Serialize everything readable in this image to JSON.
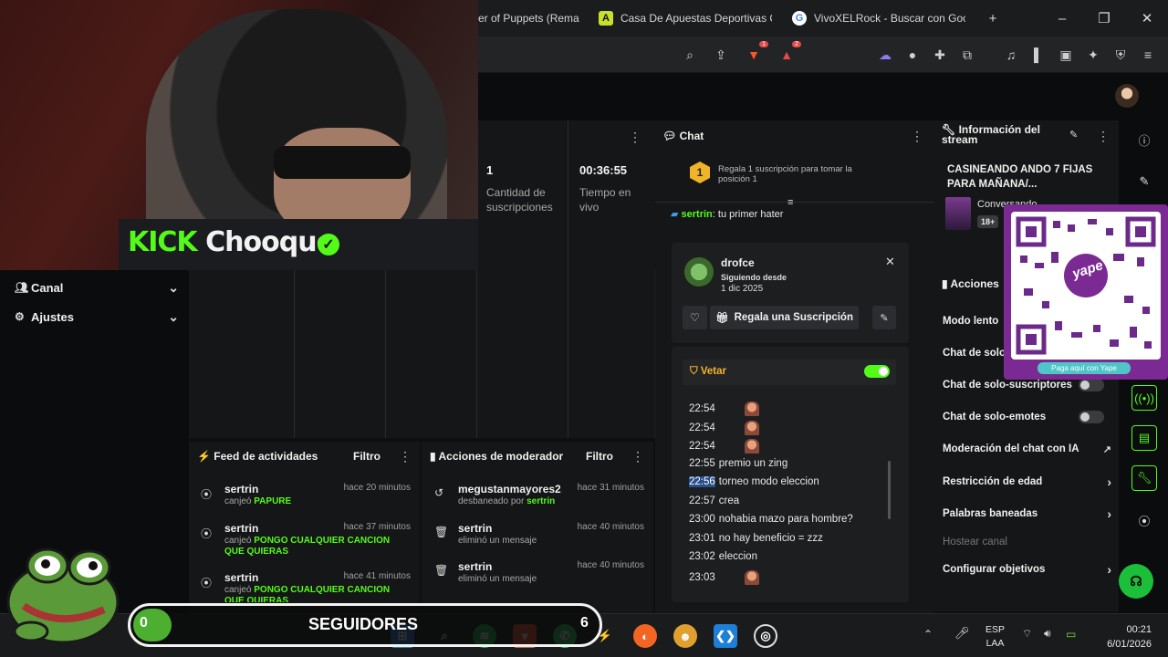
{
  "browser": {
    "tabs": [
      {
        "label": "er of Puppets (Rema",
        "favicon": ""
      },
      {
        "label": "Casa De Apuestas Deportivas C",
        "favicon": "A"
      },
      {
        "label": "VivoXELRock - Buscar con Goo",
        "favicon": "G"
      }
    ],
    "new_tab": "+",
    "window_controls": {
      "minimize": "–",
      "maximize": "❐",
      "close": "✕"
    },
    "toolbar_badges": {
      "brave": "1",
      "alerts": "2"
    }
  },
  "stream_overlay": {
    "brand": "KICK",
    "channel": "Chooque",
    "followers_label": "SEGUIDORES",
    "followers_count": "0",
    "taskbar_badge": "6",
    "qr_caption": "Paga aquí con Yape",
    "qr_brand": "yape"
  },
  "sidebar": {
    "items": [
      {
        "label": "Canal",
        "icon": "people-icon"
      },
      {
        "label": "Ajustes",
        "icon": "gear-icon"
      }
    ]
  },
  "stats": [
    {
      "value": "1",
      "label": "Cantidad de suscripciones"
    },
    {
      "value": "00:36:55",
      "label": "Tiempo en vivo"
    }
  ],
  "activity_feed": {
    "title": "Feed de actividades",
    "filter": "Filtro",
    "items": [
      {
        "user": "sertrin",
        "time": "hace 20 minutos",
        "action": "canjeó",
        "reward": "PAPURE"
      },
      {
        "user": "sertrin",
        "time": "hace 37 minutos",
        "action": "canjeó",
        "reward": "PONGO CUALQUIER CANCION QUE QUIERAS"
      },
      {
        "user": "sertrin",
        "time": "hace 41 minutos",
        "action": "canjeó",
        "reward": "PONGO CUALQUIER CANCION QUE QUIERAS"
      }
    ]
  },
  "mod_actions": {
    "title": "Acciones de moderador",
    "filter": "Filtro",
    "items": [
      {
        "user": "megustanmayores2",
        "time": "hace 31 minutos",
        "desc": "desbaneado por",
        "by": "sertrin"
      },
      {
        "user": "sertrin",
        "time": "hace 40 minutos",
        "desc": "eliminó un mensaje",
        "by": ""
      },
      {
        "user": "sertrin",
        "time": "hace 40 minutos",
        "desc": "eliminó un mensaje",
        "by": ""
      }
    ]
  },
  "chat": {
    "title": "Chat",
    "gift_prompt": "Regala 1 suscripción para tomar la posición 1",
    "gift_rank": "1",
    "pinned_user": "sertrin",
    "pinned_msg": ": tu primer hater",
    "user_card": {
      "username": "drofce",
      "following_label": "Siguiendo desde",
      "following_date": "1 dic 2025",
      "gift_button": "Regala una Suscripción"
    },
    "veto": {
      "label": "Vetar",
      "enabled": true
    },
    "messages": [
      {
        "time": "22:54",
        "text": "",
        "emote": true
      },
      {
        "time": "22:54",
        "text": "",
        "emote": true
      },
      {
        "time": "22:54",
        "text": "",
        "emote": true
      },
      {
        "time": "22:55",
        "text": "premio un zing",
        "emote": false
      },
      {
        "time": "22:56",
        "text": "torneo modo eleccion",
        "emote": false,
        "highlight": true
      },
      {
        "time": "22:57",
        "text": "crea",
        "emote": false
      },
      {
        "time": "23:00",
        "text": "nohabia mazo para hombre?",
        "emote": false
      },
      {
        "time": "23:01",
        "text": "no hay beneficio = zzz",
        "emote": false
      },
      {
        "time": "23:02",
        "text": "eleccion",
        "emote": false
      },
      {
        "time": "23:03",
        "text": "",
        "emote": true
      }
    ]
  },
  "stream_info": {
    "title": "Información del stream",
    "stream_title": "CASINEANDO ANDO 7 FIJAS PARA MAÑANA/...",
    "category": "Conversando",
    "age_badge": "18+"
  },
  "actions": {
    "title": "Acciones",
    "items": [
      {
        "label": "Modo lento",
        "control": "none"
      },
      {
        "label": "Chat de solo",
        "control": "none"
      },
      {
        "label": "Chat de solo-suscriptores",
        "control": "toggle",
        "on": false
      },
      {
        "label": "Chat de solo-emotes",
        "control": "toggle",
        "on": false
      },
      {
        "label": "Moderación del chat con IA",
        "control": "external"
      },
      {
        "label": "Restricción de edad",
        "control": "chevron"
      },
      {
        "label": "Palabras baneadas",
        "control": "chevron"
      },
      {
        "label": "Hostear canal",
        "control": "disabled"
      },
      {
        "label": "Configurar objetivos",
        "control": "chevron"
      }
    ]
  },
  "system_tray": {
    "lang_line1": "ESP",
    "lang_line2": "LAA",
    "time": "00:21",
    "date": "6/01/2026"
  },
  "colors": {
    "accent": "#53fc18",
    "panel": "#151617",
    "background": "#0e0f10",
    "qr_purple": "#7b2a93"
  }
}
